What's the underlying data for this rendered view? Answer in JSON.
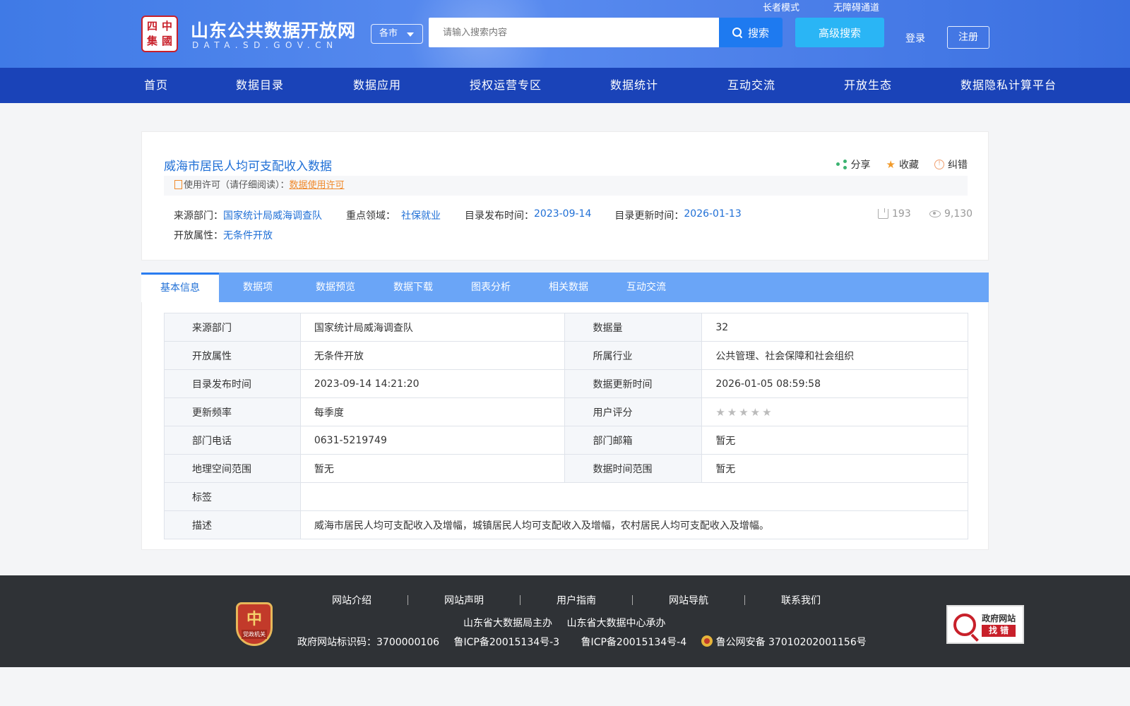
{
  "header": {
    "logo_chars": [
      "四",
      "中",
      "集",
      "國"
    ],
    "site_title": "山东公共数据开放网",
    "site_subtitle": "DATA.SD.GOV.CN",
    "city_select": "各市",
    "search_placeholder": "请输入搜索内容",
    "search_label": "搜索",
    "advanced_search_label": "高级搜索",
    "elder_mode": "长者模式",
    "accessibility": "无障碍通道",
    "login": "登录",
    "register": "注册"
  },
  "nav": {
    "items": [
      "首页",
      "数据目录",
      "数据应用",
      "授权运营专区",
      "数据统计",
      "互动交流",
      "开放生态",
      "数据隐私计算平台"
    ]
  },
  "detail": {
    "title": "威海市居民人均可支配收入数据",
    "share": "分享",
    "favorite": "收藏",
    "report_error": "纠错",
    "license_prefix": "使用许可（请仔细阅读）：",
    "license_link": "数据使用许可",
    "source_dept_label": "来源部门：",
    "source_dept": "国家统计局威海调查队",
    "key_area_label": "重点领域：",
    "key_area": "社保就业",
    "publish_label": "目录发布时间：",
    "publish_date": "2023-09-14",
    "update_label": "目录更新时间：",
    "update_date": "2026-01-13",
    "open_attr_label": "开放属性：",
    "open_attr": "无条件开放",
    "downloads": "193",
    "views": "9,130"
  },
  "tabs": [
    "基本信息",
    "数据项",
    "数据预览",
    "数据下载",
    "图表分析",
    "相关数据",
    "互动交流"
  ],
  "info_table": {
    "rows": [
      {
        "l1": "来源部门",
        "v1": "国家统计局威海调查队",
        "l2": "数据量",
        "v2": "32"
      },
      {
        "l1": "开放属性",
        "v1": "无条件开放",
        "l2": "所属行业",
        "v2": "公共管理、社会保障和社会组织"
      },
      {
        "l1": "目录发布时间",
        "v1": "2023-09-14 14:21:20",
        "l2": "数据更新时间",
        "v2": "2026-01-05 08:59:58"
      },
      {
        "l1": "更新频率",
        "v1": "每季度",
        "l2": "用户评分",
        "v2": ""
      },
      {
        "l1": "部门电话",
        "v1": "0631-5219749",
        "l2": "部门邮箱",
        "v2": "暂无"
      },
      {
        "l1": "地理空间范围",
        "v1": "暂无",
        "l2": "数据时间范围",
        "v2": "暂无"
      }
    ],
    "tag_label": "标签",
    "tag_value": "",
    "desc_label": "描述",
    "desc_value": "威海市居民人均可支配收入及增幅，城镇居民人均可支配收入及增幅，农村居民人均可支配收入及增幅。",
    "rating_stars": "★★★★★"
  },
  "footer": {
    "links": [
      "网站介绍",
      "网站声明",
      "用户指南",
      "网站导航",
      "联系我们"
    ],
    "sponsor": "山东省大数据局主办",
    "organizer": "山东省大数据中心承办",
    "gov_id": "政府网站标识码：3700000106",
    "icp3": "鲁ICP备20015134号-3",
    "icp4": "鲁ICP备20015134号-4",
    "police": "鲁公网安备 37010202001156号",
    "emblem_main": "中",
    "emblem_sub": "党政机关",
    "gov_badge_top": "政府网站",
    "gov_badge_bottom": "找 错"
  },
  "colors": {
    "header_blue": "#4a82ea",
    "nav_blue": "#1a43b8",
    "tab_blue": "#6aa5f7",
    "link_blue": "#1f6fd6",
    "license_orange": "#f08a2c",
    "footer_bg": "#2f3236"
  }
}
